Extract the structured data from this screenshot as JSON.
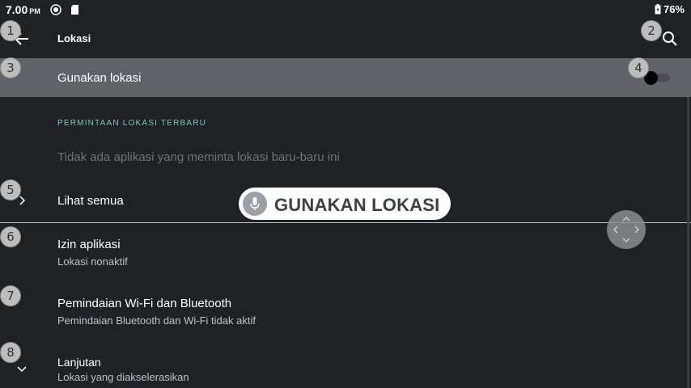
{
  "status_bar": {
    "time": "7.00",
    "ampm": "PM",
    "battery": "76%",
    "icons": [
      "notification-icon",
      "sd-card-icon",
      "battery-icon"
    ]
  },
  "toolbar": {
    "back_icon": "arrow-left-icon",
    "title": "Lokasi",
    "search_icon": "search-icon"
  },
  "master_switch": {
    "label": "Gunakan lokasi",
    "on": false
  },
  "recent": {
    "header": "PERMINTAAN LOKASI TERBARU",
    "empty_text": "Tidak ada aplikasi yang meminta lokasi baru-baru ini"
  },
  "items": [
    {
      "title": "Lihat semua",
      "subtitle": "",
      "icon": "chevron-right-icon"
    },
    {
      "title": "Izin aplikasi",
      "subtitle": "Lokasi nonaktif",
      "icon": ""
    },
    {
      "title": "Pemindaian Wi-Fi dan Bluetooth",
      "subtitle": "Pemindaian Bluetooth dan Wi-Fi tidak aktif",
      "icon": ""
    },
    {
      "title": "Lanjutan",
      "subtitle": "Lokasi yang diakselerasikan",
      "icon": "chevron-down-icon"
    }
  ],
  "annotations": [
    "1",
    "2",
    "3",
    "4",
    "5",
    "6",
    "7",
    "8"
  ],
  "voice_overlay": {
    "text": "GUNAKAN LOKASI",
    "icon": "mic-icon"
  },
  "colors": {
    "background": "#202124",
    "highlight_row": "#5f6368",
    "accent": "#78c8bc"
  }
}
